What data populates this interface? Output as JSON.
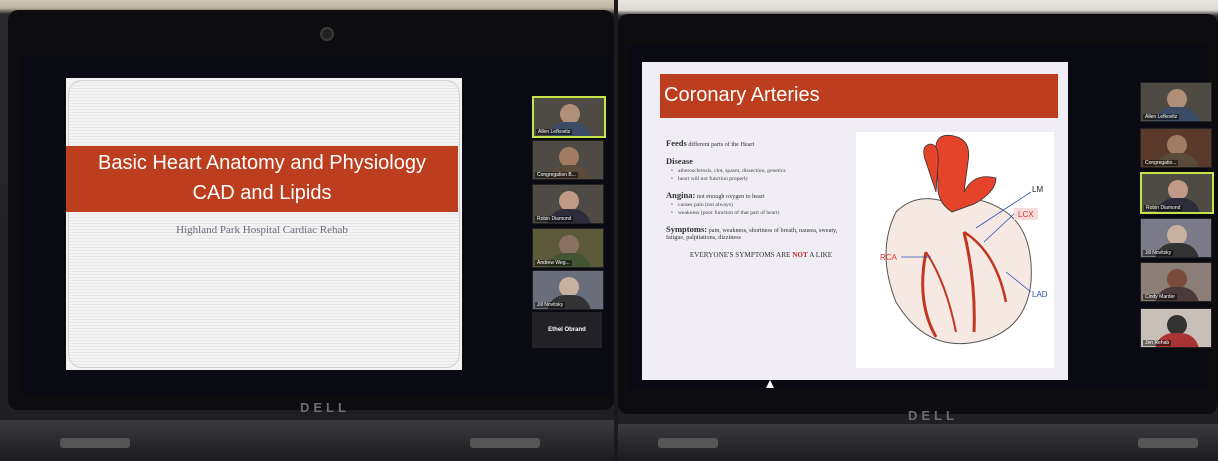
{
  "left_slide": {
    "title_line1": "Basic Heart Anatomy and Physiology",
    "title_line2": "CAD and Lipids",
    "subtitle": "Highland Park Hospital Cardiac Rehab"
  },
  "left_participants": [
    {
      "name": "Allen Lefkovitz",
      "active": true
    },
    {
      "name": "Congregation B..."
    },
    {
      "name": "Robin Diamond"
    },
    {
      "name": "Andrew Weg..."
    },
    {
      "name": "Jill Novitsky"
    }
  ],
  "left_blank_tile": "Ethel Obrand",
  "right_slide": {
    "title": "Coronary Arteries",
    "feeds_bold": "Feeds",
    "feeds_rest": " different parts of the Heart",
    "disease_heading": "Disease",
    "disease_bullets": [
      "atherosclerosis, clot, spasm, dissection, genetics",
      "heart will not function properly"
    ],
    "angina_bold": "Angina:",
    "angina_rest": " not enough oxygen to heart",
    "angina_bullets": [
      "causes pain (not always)",
      "weakness (poor function of that part of heart)"
    ],
    "symptoms_bold": "Symptoms:",
    "symptoms_rest": " pain, weakness, shortness of breath, nausea, sweaty, fatigue, palpitations, dizziness",
    "everyone_pre": "EVERYONE'S SYMPTOMS ARE ",
    "everyone_not": "NOT",
    "everyone_post": " A LIKE",
    "labels": {
      "lm": "LM",
      "lcx": "LCX",
      "rca": "RCA",
      "lad": "LAD"
    }
  },
  "right_participants": [
    {
      "name": "Allen Lefkovitz"
    },
    {
      "name": "Congregatio..."
    },
    {
      "name": "Robin Diamond",
      "active": true
    },
    {
      "name": "Jill Novitsky"
    },
    {
      "name": "Cindy Marder"
    },
    {
      "name": "Jen Rehab"
    }
  ],
  "brand": "DELL",
  "colors": {
    "banner": "#bd3d1f",
    "active_tile": "#c7e34a"
  }
}
